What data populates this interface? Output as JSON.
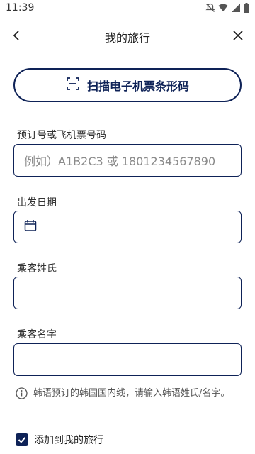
{
  "status_bar": {
    "time": "11:39",
    "icons": [
      "notifications-off-icon",
      "wifi-icon",
      "signal-icon",
      "battery-icon"
    ]
  },
  "header": {
    "title": "我的旅行",
    "back_icon": "back-arrow-icon",
    "close_icon": "close-icon"
  },
  "scan_button": {
    "label": "扫描电子机票条形码",
    "icon": "barcode-scan-icon"
  },
  "fields": {
    "booking": {
      "label": "预订号或飞机票号码",
      "placeholder": "例如）A1B2C3 或 1801234567890",
      "value": ""
    },
    "date": {
      "label": "出发日期",
      "icon": "calendar-icon",
      "value": ""
    },
    "surname": {
      "label": "乘客姓氏",
      "value": ""
    },
    "given_name": {
      "label": "乘客名字",
      "value": ""
    }
  },
  "info": {
    "icon": "info-icon",
    "text": "韩语预订的韩国国内线，请输入韩语姓氏/名字。"
  },
  "checkbox": {
    "label": "添加到我的旅行",
    "checked": true
  },
  "colors": {
    "accent": "#0e2257",
    "placeholder": "#8a8a8a"
  }
}
